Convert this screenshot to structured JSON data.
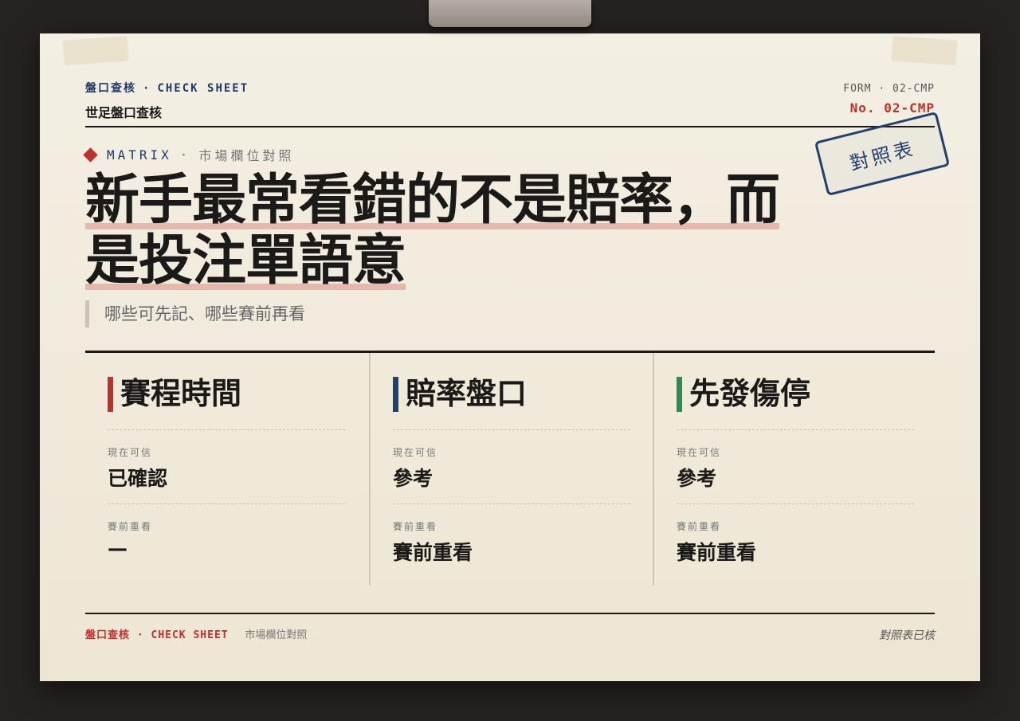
{
  "header": {
    "kicker": "盤口查核",
    "kicker_en": "CHECK SHEET",
    "separator": "·",
    "subtitle": "世足盤口查核",
    "form_code": "FORM · 02-CMP",
    "form_no": "No. 02-CMP"
  },
  "stamp": {
    "label": "對照表"
  },
  "section": {
    "tag": "MATRIX",
    "separator": "·",
    "tag_zh": "市場欄位對照",
    "headline_line1": "新手最常看錯的不是賠率，而",
    "headline_line2": "是投注單語意",
    "subline": "哪些可先記、哪些賽前再看"
  },
  "columns": [
    {
      "title": "賽程時間",
      "accent": "#c0302a",
      "now_label": "現在可信",
      "now_value": "已確認",
      "later_label": "賽前重看",
      "later_value": "—"
    },
    {
      "title": "賠率盤口",
      "accent": "#23416f",
      "now_label": "現在可信",
      "now_value": "參考",
      "later_label": "賽前重看",
      "later_value": "賽前重看"
    },
    {
      "title": "先發傷停",
      "accent": "#2e8b57",
      "now_label": "現在可信",
      "now_value": "參考",
      "later_label": "賽前重看",
      "later_value": "賽前重看"
    }
  ],
  "footer": {
    "kicker": "盤口查核",
    "kicker_en": "CHECK SHEET",
    "separator": "·",
    "note": "市場欄位對照",
    "verified": "對照表已核"
  }
}
